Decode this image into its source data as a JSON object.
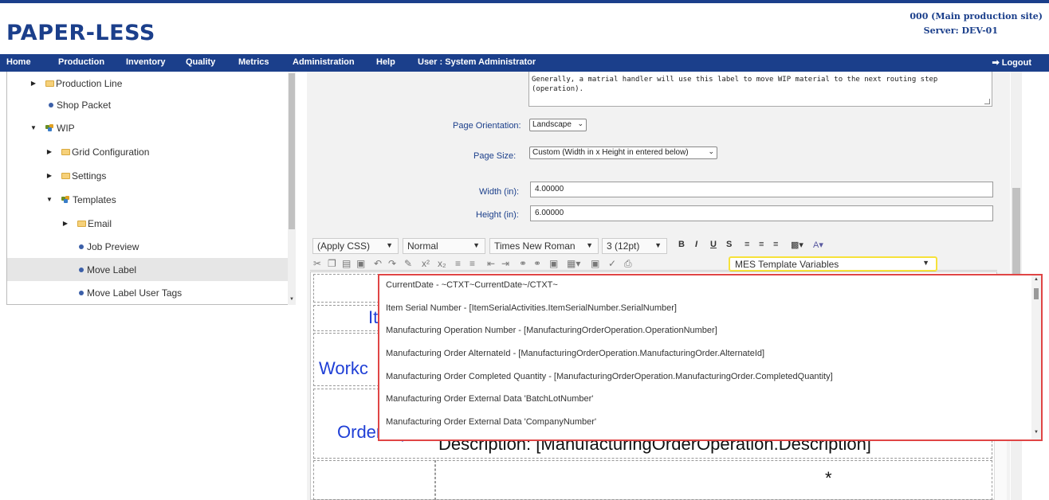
{
  "header": {
    "logo": "PAPER-LESS",
    "site": "000 (Main production site)",
    "server": "Server: DEV-01"
  },
  "nav": {
    "items": [
      "Home",
      "Production",
      "Inventory",
      "Quality",
      "Metrics",
      "Administration",
      "Help",
      "User : System Administrator"
    ],
    "logout": "Logout"
  },
  "tree": {
    "items": [
      {
        "label": "Production Line"
      },
      {
        "label": "Shop Packet"
      },
      {
        "label": "WIP"
      },
      {
        "label": "Grid Configuration"
      },
      {
        "label": "Settings"
      },
      {
        "label": "Templates"
      },
      {
        "label": "Email"
      },
      {
        "label": "Job Preview"
      },
      {
        "label": "Move Label"
      },
      {
        "label": "Move Label User Tags"
      }
    ]
  },
  "form": {
    "description": "Generally, a matrial handler will use this label to move WIP material to the next routing step (operation).",
    "orientation_label": "Page Orientation:",
    "orientation_value": "Landscape",
    "size_label": "Page Size:",
    "size_value": "Custom (Width in x Height in entered below)",
    "width_label": "Width (in):",
    "width_value": "4.00000",
    "height_label": "Height (in):",
    "height_value": "6.00000"
  },
  "toolbar": {
    "css": "(Apply CSS)",
    "style": "Normal",
    "font": "Times New Roman",
    "size": "3 (12pt)",
    "bold": "B",
    "italic": "I",
    "underline": "U",
    "strike": "S",
    "variables": "MES Template Variables"
  },
  "editor": {
    "it": "It",
    "workc": "Workc",
    "orderop": "Order/Op:",
    "description_line": "Description:  [ManufacturingOrderOperation.Description]",
    "star": "*"
  },
  "dropdown": {
    "items": [
      "CurrentDate - ~CTXT~CurrentDate~/CTXT~",
      "Item Serial Number - [ItemSerialActivities.ItemSerialNumber.SerialNumber]",
      "Manufacturing Operation Number - [ManufacturingOrderOperation.OperationNumber]",
      "Manufacturing Order AlternateId - [ManufacturingOrderOperation.ManufacturingOrder.AlternateId]",
      "Manufacturing Order Completed Quantity - [ManufacturingOrderOperation.ManufacturingOrder.CompletedQuantity]",
      "Manufacturing Order External Data 'BatchLotNumber'",
      "Manufacturing Order External Data 'CompanyNumber'"
    ]
  }
}
